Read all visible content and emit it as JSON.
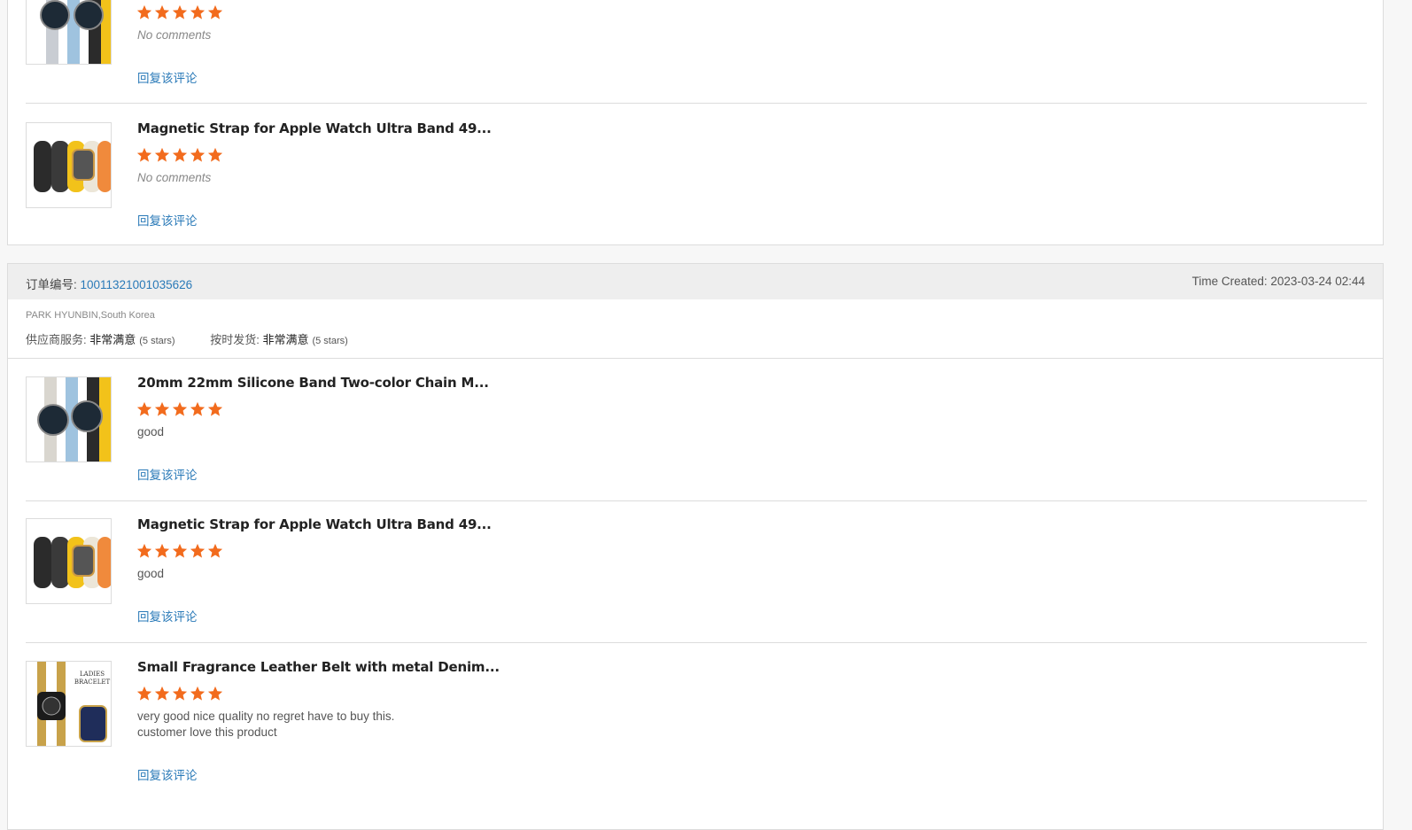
{
  "block1": {
    "items": [
      {
        "title": "",
        "stars": 5,
        "comment": "No comments",
        "reply": "回复该评论",
        "image": "watch-band-silicone"
      },
      {
        "title": "Magnetic Strap for Apple Watch Ultra Band 49...",
        "stars": 5,
        "comment": "No comments",
        "reply": "回复该评论",
        "image": "watch-band-magnetic"
      }
    ]
  },
  "order": {
    "label": "订单编号: ",
    "number": "10011321001035626",
    "time_created": "Time Created: 2023-03-24 02:44",
    "buyer": "PARK HYUNBIN,South Korea",
    "supplier_label": "供应商服务: ",
    "supplier_value": "非常满意",
    "supplier_stars": "(5 stars)",
    "delivery_label": "按时发货: ",
    "delivery_value": "非常满意",
    "delivery_stars": "(5 stars)",
    "items": [
      {
        "title": "20mm 22mm Silicone Band Two-color Chain M...",
        "stars": 5,
        "comment": "good",
        "reply": "回复该评论",
        "image": "watch-band-silicone"
      },
      {
        "title": "Magnetic Strap for Apple Watch Ultra Band 49...",
        "stars": 5,
        "comment": "good",
        "reply": "回复该评论",
        "image": "watch-band-magnetic"
      },
      {
        "title": "Small Fragrance Leather Belt with metal Denim...",
        "stars": 5,
        "comment_line1": "very good nice quality no regret have to buy this.",
        "comment_line2": "customer love this product",
        "reply": "回复该评论",
        "image": "watch-band-chain"
      }
    ]
  },
  "colors": {
    "star": "#f26b1d",
    "link": "#2a7ab8"
  }
}
